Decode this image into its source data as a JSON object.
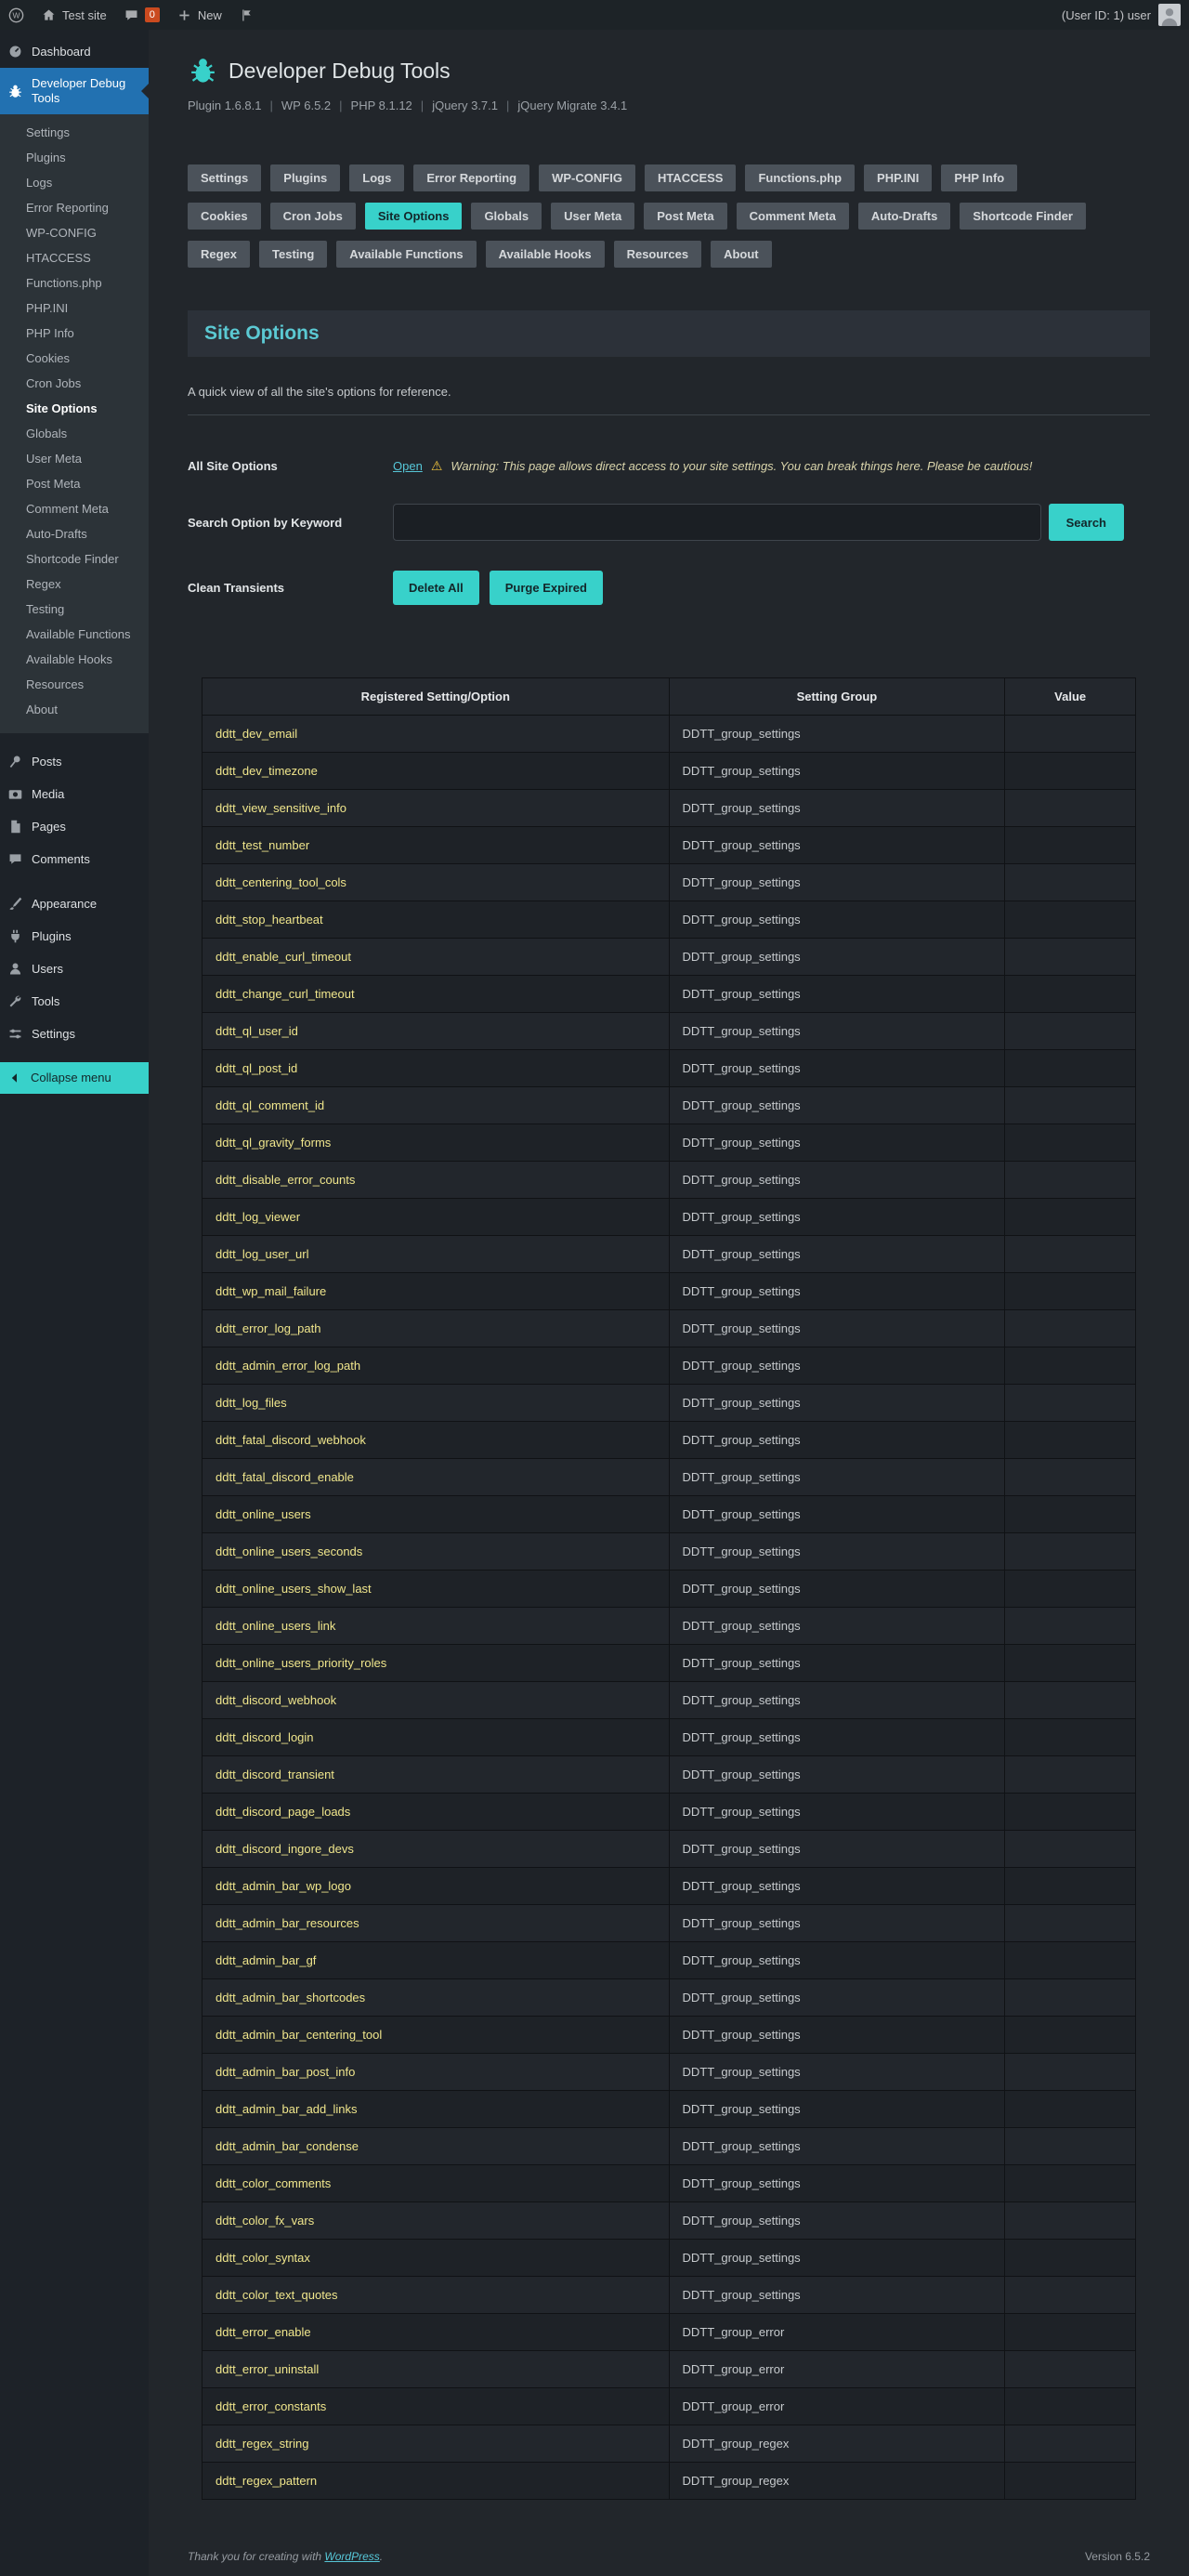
{
  "colors": {
    "accent": "#38d1ca",
    "accent-text": "#13272a",
    "sidebar-active": "#2271b1",
    "option-name": "#f0e68c",
    "link": "#56c7d8",
    "heading": "#5bc9d3",
    "warning-text": "#d9d4ab",
    "warning-icon": "#f0c33c"
  },
  "admin_bar": {
    "site_name": "Test site",
    "comments_count": "0",
    "new_label": "New",
    "user_label": "(User ID: 1) user"
  },
  "sidebar": {
    "items": [
      {
        "label": "Dashboard"
      },
      {
        "label": "Developer Debug Tools"
      },
      {
        "label": "Posts"
      },
      {
        "label": "Media"
      },
      {
        "label": "Pages"
      },
      {
        "label": "Comments"
      },
      {
        "label": "Appearance"
      },
      {
        "label": "Plugins"
      },
      {
        "label": "Users"
      },
      {
        "label": "Tools"
      },
      {
        "label": "Settings"
      }
    ],
    "submenu": [
      {
        "label": "Settings"
      },
      {
        "label": "Plugins"
      },
      {
        "label": "Logs"
      },
      {
        "label": "Error Reporting"
      },
      {
        "label": "WP-CONFIG"
      },
      {
        "label": "HTACCESS"
      },
      {
        "label": "Functions.php"
      },
      {
        "label": "PHP.INI"
      },
      {
        "label": "PHP Info"
      },
      {
        "label": "Cookies"
      },
      {
        "label": "Cron Jobs"
      },
      {
        "label": "Site Options",
        "current": true
      },
      {
        "label": "Globals"
      },
      {
        "label": "User Meta"
      },
      {
        "label": "Post Meta"
      },
      {
        "label": "Comment Meta"
      },
      {
        "label": "Auto-Drafts"
      },
      {
        "label": "Shortcode Finder"
      },
      {
        "label": "Regex"
      },
      {
        "label": "Testing"
      },
      {
        "label": "Available Functions"
      },
      {
        "label": "Available Hooks"
      },
      {
        "label": "Resources"
      },
      {
        "label": "About"
      }
    ],
    "collapse_label": "Collapse menu"
  },
  "header": {
    "title": "Developer Debug Tools",
    "separator": "|",
    "meta": [
      "Plugin 1.6.8.1",
      "WP 6.5.2",
      "PHP 8.1.12",
      "jQuery 3.7.1",
      "jQuery Migrate 3.4.1"
    ]
  },
  "tabs": [
    {
      "label": "Settings"
    },
    {
      "label": "Plugins"
    },
    {
      "label": "Logs"
    },
    {
      "label": "Error Reporting"
    },
    {
      "label": "WP-CONFIG"
    },
    {
      "label": "HTACCESS"
    },
    {
      "label": "Functions.php"
    },
    {
      "label": "PHP.INI"
    },
    {
      "label": "PHP Info"
    },
    {
      "label": "Cookies"
    },
    {
      "label": "Cron Jobs"
    },
    {
      "label": "Site Options",
      "active": true
    },
    {
      "label": "Globals"
    },
    {
      "label": "User Meta"
    },
    {
      "label": "Post Meta"
    },
    {
      "label": "Comment Meta"
    },
    {
      "label": "Auto-Drafts"
    },
    {
      "label": "Shortcode Finder"
    },
    {
      "label": "Regex"
    },
    {
      "label": "Testing"
    },
    {
      "label": "Available Functions"
    },
    {
      "label": "Available Hooks"
    },
    {
      "label": "Resources"
    },
    {
      "label": "About"
    }
  ],
  "page": {
    "title": "Site Options",
    "description": "A quick view of all the site's options for reference.",
    "rows": {
      "all_label": "All Site Options",
      "open_link": "Open",
      "warning_icon": "⚠",
      "warning_text": "Warning: This page allows direct access to your site settings. You can break things here. Please be cautious!",
      "search_label": "Search Option by Keyword",
      "search_value": "",
      "search_button": "Search",
      "transients_label": "Clean Transients",
      "delete_all": "Delete All",
      "purge_expired": "Purge Expired"
    }
  },
  "table": {
    "headers": [
      "Registered Setting/Option",
      "Setting Group",
      "Value"
    ],
    "rows": [
      [
        "ddtt_dev_email",
        "DDTT_group_settings",
        ""
      ],
      [
        "ddtt_dev_timezone",
        "DDTT_group_settings",
        ""
      ],
      [
        "ddtt_view_sensitive_info",
        "DDTT_group_settings",
        ""
      ],
      [
        "ddtt_test_number",
        "DDTT_group_settings",
        ""
      ],
      [
        "ddtt_centering_tool_cols",
        "DDTT_group_settings",
        ""
      ],
      [
        "ddtt_stop_heartbeat",
        "DDTT_group_settings",
        ""
      ],
      [
        "ddtt_enable_curl_timeout",
        "DDTT_group_settings",
        ""
      ],
      [
        "ddtt_change_curl_timeout",
        "DDTT_group_settings",
        ""
      ],
      [
        "ddtt_ql_user_id",
        "DDTT_group_settings",
        ""
      ],
      [
        "ddtt_ql_post_id",
        "DDTT_group_settings",
        ""
      ],
      [
        "ddtt_ql_comment_id",
        "DDTT_group_settings",
        ""
      ],
      [
        "ddtt_ql_gravity_forms",
        "DDTT_group_settings",
        ""
      ],
      [
        "ddtt_disable_error_counts",
        "DDTT_group_settings",
        ""
      ],
      [
        "ddtt_log_viewer",
        "DDTT_group_settings",
        ""
      ],
      [
        "ddtt_log_user_url",
        "DDTT_group_settings",
        ""
      ],
      [
        "ddtt_wp_mail_failure",
        "DDTT_group_settings",
        ""
      ],
      [
        "ddtt_error_log_path",
        "DDTT_group_settings",
        ""
      ],
      [
        "ddtt_admin_error_log_path",
        "DDTT_group_settings",
        ""
      ],
      [
        "ddtt_log_files",
        "DDTT_group_settings",
        ""
      ],
      [
        "ddtt_fatal_discord_webhook",
        "DDTT_group_settings",
        ""
      ],
      [
        "ddtt_fatal_discord_enable",
        "DDTT_group_settings",
        ""
      ],
      [
        "ddtt_online_users",
        "DDTT_group_settings",
        ""
      ],
      [
        "ddtt_online_users_seconds",
        "DDTT_group_settings",
        ""
      ],
      [
        "ddtt_online_users_show_last",
        "DDTT_group_settings",
        ""
      ],
      [
        "ddtt_online_users_link",
        "DDTT_group_settings",
        ""
      ],
      [
        "ddtt_online_users_priority_roles",
        "DDTT_group_settings",
        ""
      ],
      [
        "ddtt_discord_webhook",
        "DDTT_group_settings",
        ""
      ],
      [
        "ddtt_discord_login",
        "DDTT_group_settings",
        ""
      ],
      [
        "ddtt_discord_transient",
        "DDTT_group_settings",
        ""
      ],
      [
        "ddtt_discord_page_loads",
        "DDTT_group_settings",
        ""
      ],
      [
        "ddtt_discord_ingore_devs",
        "DDTT_group_settings",
        ""
      ],
      [
        "ddtt_admin_bar_wp_logo",
        "DDTT_group_settings",
        ""
      ],
      [
        "ddtt_admin_bar_resources",
        "DDTT_group_settings",
        ""
      ],
      [
        "ddtt_admin_bar_gf",
        "DDTT_group_settings",
        ""
      ],
      [
        "ddtt_admin_bar_shortcodes",
        "DDTT_group_settings",
        ""
      ],
      [
        "ddtt_admin_bar_centering_tool",
        "DDTT_group_settings",
        ""
      ],
      [
        "ddtt_admin_bar_post_info",
        "DDTT_group_settings",
        ""
      ],
      [
        "ddtt_admin_bar_add_links",
        "DDTT_group_settings",
        ""
      ],
      [
        "ddtt_admin_bar_condense",
        "DDTT_group_settings",
        ""
      ],
      [
        "ddtt_color_comments",
        "DDTT_group_settings",
        ""
      ],
      [
        "ddtt_color_fx_vars",
        "DDTT_group_settings",
        ""
      ],
      [
        "ddtt_color_syntax",
        "DDTT_group_settings",
        ""
      ],
      [
        "ddtt_color_text_quotes",
        "DDTT_group_settings",
        ""
      ],
      [
        "ddtt_error_enable",
        "DDTT_group_error",
        ""
      ],
      [
        "ddtt_error_uninstall",
        "DDTT_group_error",
        ""
      ],
      [
        "ddtt_error_constants",
        "DDTT_group_error",
        ""
      ],
      [
        "ddtt_regex_string",
        "DDTT_group_regex",
        ""
      ],
      [
        "ddtt_regex_pattern",
        "DDTT_group_regex",
        ""
      ]
    ]
  },
  "footer": {
    "thanks_prefix": "Thank you for creating with",
    "thanks_link": "WordPress",
    "thanks_suffix": ".",
    "version": "Version 6.5.2"
  }
}
